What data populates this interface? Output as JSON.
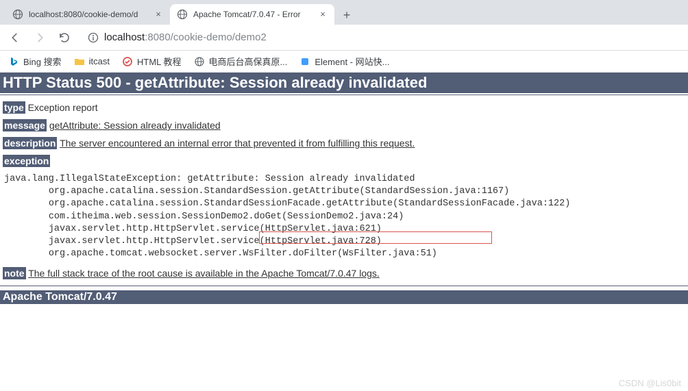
{
  "chrome": {
    "tabs": [
      {
        "title": "localhost:8080/cookie-demo/d"
      },
      {
        "title": "Apache Tomcat/7.0.47 - Error "
      }
    ],
    "active_tab_index": 1,
    "url_host": "localhost",
    "url_port_path": ":8080/cookie-demo/demo2",
    "bookmarks": [
      {
        "label": "Bing 搜索"
      },
      {
        "label": "itcast"
      },
      {
        "label": "HTML 教程"
      },
      {
        "label": "电商后台高保真原..."
      },
      {
        "label": "Element - 网站快..."
      }
    ]
  },
  "error": {
    "h1": "HTTP Status 500 - getAttribute: Session already invalidated",
    "type_label": "type",
    "type_value": " Exception report",
    "message_label": "message",
    "message_value": "getAttribute: Session already invalidated",
    "description_label": "description",
    "description_value": "The server encountered an internal error that prevented it from fulfilling this request.",
    "exception_label": "exception",
    "stacktrace": "java.lang.IllegalStateException: getAttribute: Session already invalidated\n\torg.apache.catalina.session.StandardSession.getAttribute(StandardSession.java:1167)\n\torg.apache.catalina.session.StandardSessionFacade.getAttribute(StandardSessionFacade.java:122)\n\tcom.itheima.web.session.SessionDemo2.doGet(SessionDemo2.java:24)\n\tjavax.servlet.http.HttpServlet.service(HttpServlet.java:621)\n\tjavax.servlet.http.HttpServlet.service(HttpServlet.java:728)\n\torg.apache.tomcat.websocket.server.WsFilter.doFilter(WsFilter.java:51)",
    "note_label": "note",
    "note_value": "The full stack trace of the root cause is available in the Apache Tomcat/7.0.47 logs.",
    "footer": "Apache Tomcat/7.0.47"
  },
  "watermark": "CSDN @Lis0bit"
}
